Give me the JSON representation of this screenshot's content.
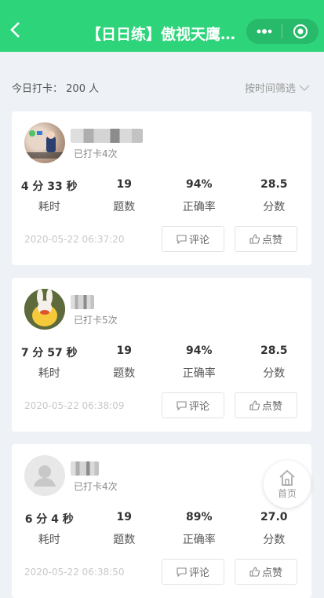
{
  "header": {
    "title": "【日日练】傲视天鹰西…"
  },
  "summary": {
    "label": "今日打卡：",
    "count": "200 人"
  },
  "filter": {
    "label": "按时间筛选"
  },
  "cards": [
    {
      "checkin": "已打卡4次",
      "time_value": "4 分 33 秒",
      "questions": "19",
      "accuracy": "94%",
      "score": "28.5",
      "timestamp": "2020-05-22 06:37:20"
    },
    {
      "checkin": "已打卡5次",
      "time_value": "7 分 57 秒",
      "questions": "19",
      "accuracy": "94%",
      "score": "28.5",
      "timestamp": "2020-05-22 06:38:09"
    },
    {
      "checkin": "已打卡4次",
      "time_value": "6 分 4 秒",
      "questions": "19",
      "accuracy": "89%",
      "score": "27.0",
      "timestamp": "2020-05-22 06:38:50"
    }
  ],
  "labels": {
    "time": "耗时",
    "questions": "题数",
    "accuracy": "正确率",
    "score": "分数",
    "comment": "评论",
    "like": "点赞"
  },
  "home": {
    "label": "首页"
  },
  "colors": {
    "primary": "#2ed47a",
    "background": "#eef1f5"
  }
}
